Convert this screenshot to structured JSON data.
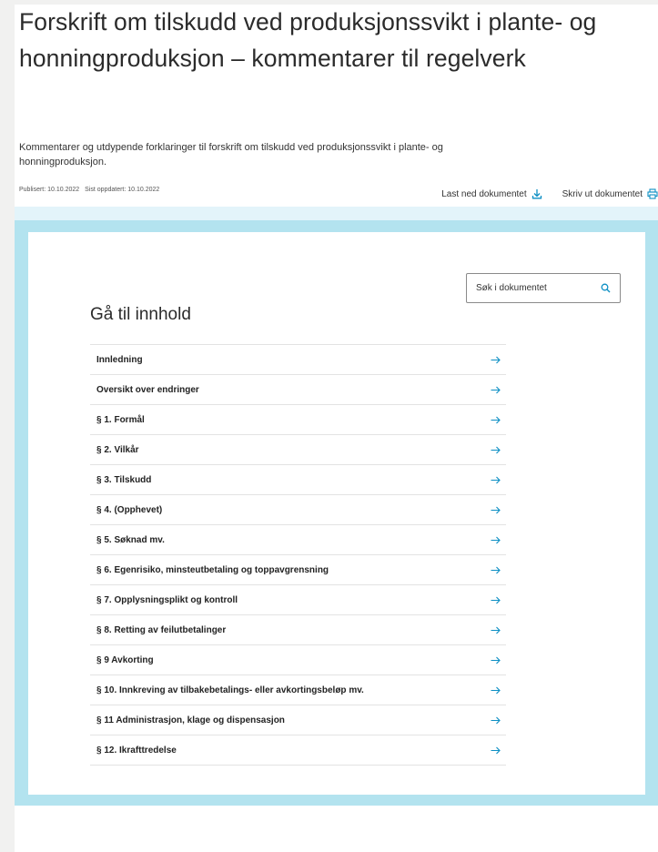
{
  "document": {
    "title": "Forskrift om tilskudd ved produksjonssvikt i plante- og honningproduksjon – kommentarer til regelverk",
    "lead": "Kommentarer og utdypende forklaringer til forskrift om tilskudd ved produksjonssvikt i plante- og honningproduksjon.",
    "published": "Publisert: 10.10.2022",
    "updated": "Sist oppdatert: 10.10.2022"
  },
  "actions": {
    "download_label": "Last ned dokumentet",
    "print_label": "Skriv ut dokumentet"
  },
  "search": {
    "placeholder": "Søk i dokumentet"
  },
  "toc": {
    "heading": "Gå til innhold",
    "items": [
      {
        "label": "Innledning"
      },
      {
        "label": "Oversikt over endringer"
      },
      {
        "label": "§ 1. Formål"
      },
      {
        "label": "§ 2. Vilkår"
      },
      {
        "label": "§ 3. Tilskudd"
      },
      {
        "label": "§ 4. (Opphevet)"
      },
      {
        "label": "§ 5. Søknad mv."
      },
      {
        "label": "§ 6. Egenrisiko, minsteutbetaling og toppavgrensning"
      },
      {
        "label": "§ 7. Opplysningsplikt og kontroll"
      },
      {
        "label": "§ 8. Retting av feilutbetalinger"
      },
      {
        "label": "§ 9 Avkorting"
      },
      {
        "label": "§ 10. Innkreving av tilbakebetalings- eller avkortingsbeløp mv."
      },
      {
        "label": "§ 11 Administrasjon, klage og dispensasjon"
      },
      {
        "label": "§ 12. Ikrafttredelse"
      }
    ]
  },
  "colors": {
    "accent": "#0d8fc4",
    "panel_border": "#b3e3ef",
    "band": "#e3f4fa"
  }
}
